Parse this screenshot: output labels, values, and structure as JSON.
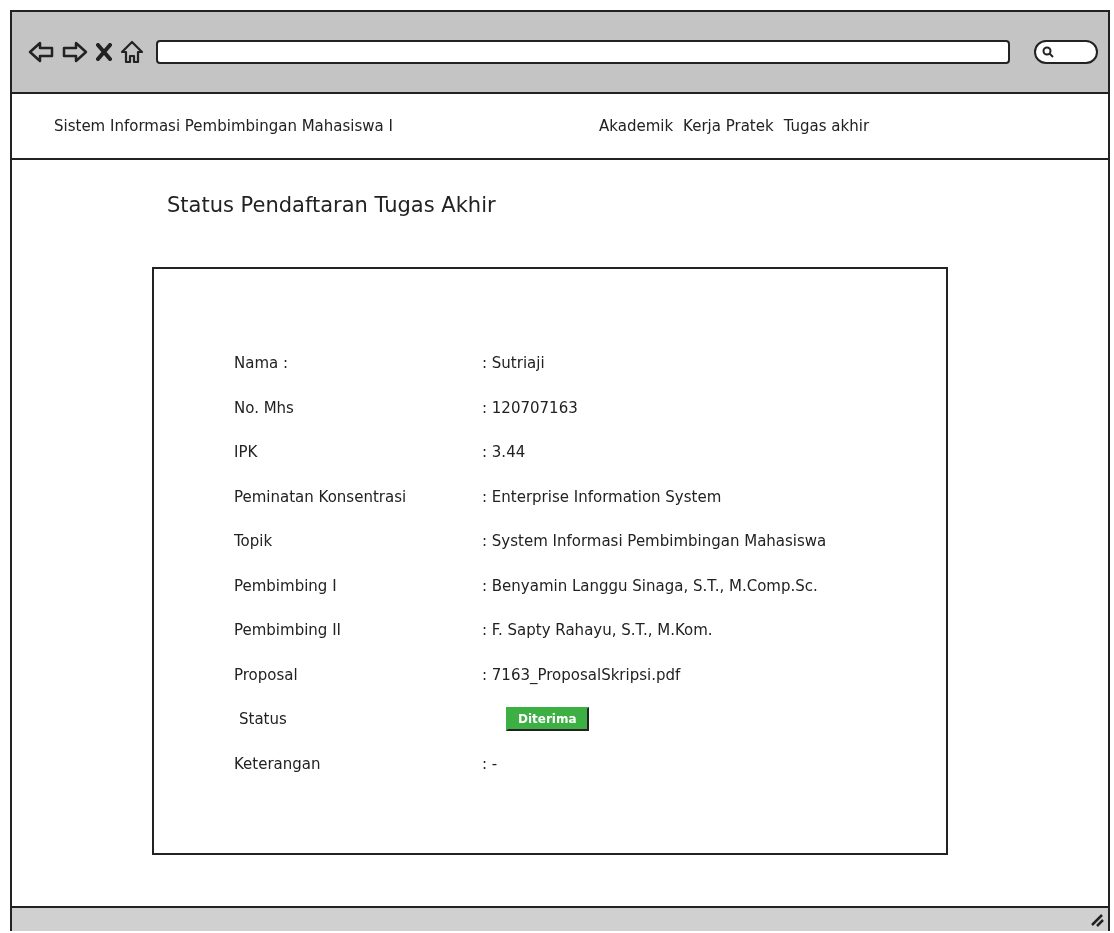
{
  "header": {
    "site_title": "Sistem Informasi Pembimbingan Mahasiswa I",
    "menu": [
      "Akademik",
      "Kerja Pratek",
      "Tugas akhir"
    ]
  },
  "page_title": "Status Pendaftaran Tugas Akhir",
  "fields": [
    {
      "kind": "text",
      "label": "Nama :",
      "value": ": Sutriaji"
    },
    {
      "kind": "text",
      "label": "No. Mhs",
      "value": ": 120707163"
    },
    {
      "kind": "text",
      "label": "IPK",
      "value": ": 3.44"
    },
    {
      "kind": "text",
      "label": "Peminatan Konsentrasi",
      "value": ": Enterprise Information System"
    },
    {
      "kind": "text",
      "label": "Topik",
      "value": ": System Informasi Pembimbingan Mahasiswa"
    },
    {
      "kind": "text",
      "label": "Pembimbing I",
      "value": ": Benyamin Langgu Sinaga, S.T., M.Comp.Sc."
    },
    {
      "kind": "text",
      "label": "Pembimbing II",
      "value": ": F. Sapty Rahayu, S.T., M.Kom."
    },
    {
      "kind": "text",
      "label": "Proposal",
      "value": ": 7163_ProposalSkripsi.pdf"
    },
    {
      "kind": "badge",
      "label": "Status",
      "value": "Diterima"
    },
    {
      "kind": "text",
      "label": "Keterangan",
      "value": ": -"
    }
  ]
}
